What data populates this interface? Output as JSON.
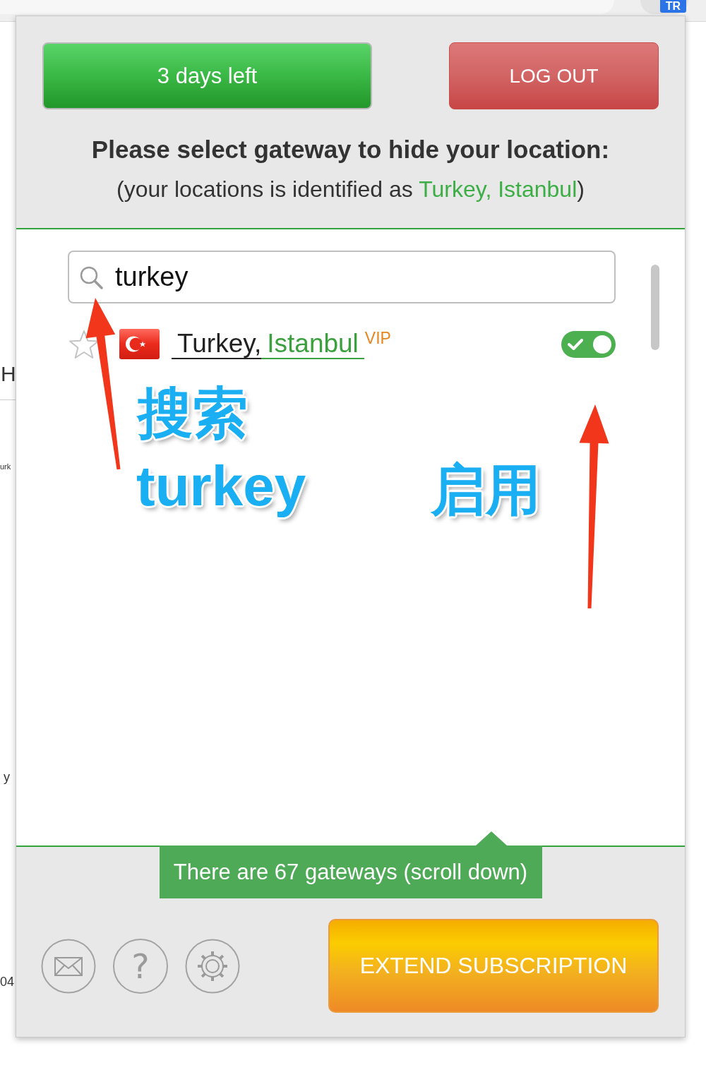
{
  "browser": {
    "extension_badge": "TR"
  },
  "background_page": {
    "fragments": [
      "H",
      "urk",
      "y",
      "04"
    ]
  },
  "popup": {
    "days_left_button": "3 days left",
    "logout_button": "LOG OUT",
    "heading": "Please select gateway to hide your location:",
    "location_note": {
      "prefix": "(your locations is identified as ",
      "location": "Turkey, Istanbul",
      "suffix": ")"
    },
    "search": {
      "value": "turkey"
    },
    "gateways": [
      {
        "country": "Turkey,",
        "city": "Istanbul",
        "badge": "VIP",
        "favorite": false,
        "enabled": true
      }
    ],
    "gateway_count_tip": "There are 67 gateways (scroll down)",
    "help_button": "?",
    "extend_button": "EXTEND SUBSCRIPTION"
  },
  "annotations": {
    "labels": [
      "搜索",
      "turkey",
      "启用"
    ]
  }
}
